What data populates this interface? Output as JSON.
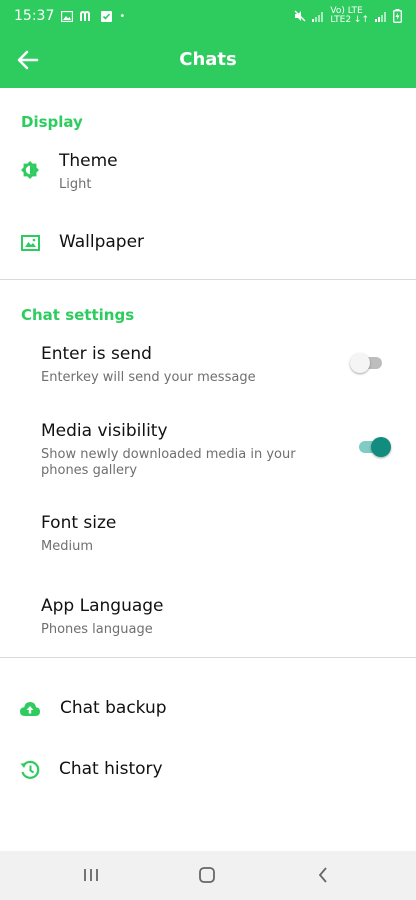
{
  "status_bar": {
    "time": "15:37",
    "dot": "•",
    "network_line1": "Vo) LTE",
    "network_line2": "LTE2 ↓↑"
  },
  "app_bar": {
    "title": "Chats",
    "back_icon": "arrow-left-icon"
  },
  "display_section": {
    "header": "Display",
    "items": [
      {
        "icon": "theme-icon",
        "title": "Theme",
        "subtitle": "Light"
      },
      {
        "icon": "wallpaper-icon",
        "title": "Wallpaper"
      }
    ]
  },
  "chat_settings_section": {
    "header": "Chat settings",
    "items": [
      {
        "title": "Enter is send",
        "subtitle": "Enterkey will send your message",
        "toggle": false
      },
      {
        "title": "Media visibility",
        "subtitle": "Show newly downloaded media in your phones gallery",
        "toggle": true
      },
      {
        "title": "Font size",
        "subtitle": "Medium"
      },
      {
        "title": "App Language",
        "subtitle": "Phones language"
      }
    ]
  },
  "extra_items": [
    {
      "icon": "cloud-upload-icon",
      "title": "Chat backup"
    },
    {
      "icon": "history-icon",
      "title": "Chat history"
    }
  ],
  "colors": {
    "accent": "#2ecc5f",
    "toggle_on": "#128c7e"
  }
}
